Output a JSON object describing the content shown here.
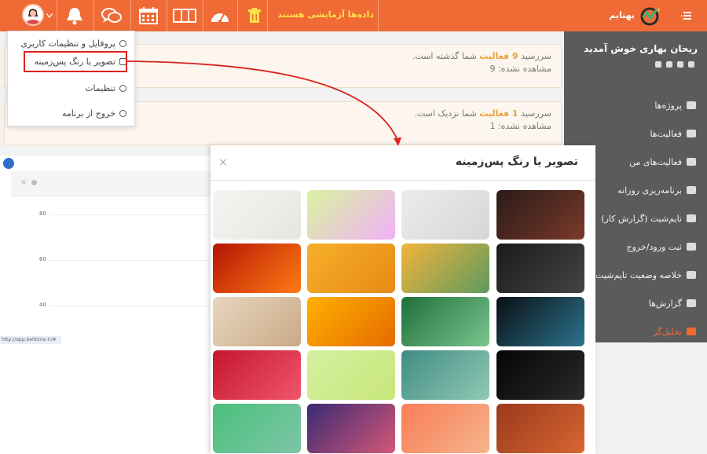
{
  "topbar": {
    "trial_label": "داده‌ها آزمایشی هستند",
    "brand": "بهتایم",
    "bg": "#f06a35"
  },
  "sidebar": {
    "welcome": "ریحان بهاری خوش آمدید",
    "items": [
      {
        "label": "پروژه‌ها",
        "icon": "projects-icon"
      },
      {
        "label": "فعالیت‌ها",
        "icon": "activities-icon"
      },
      {
        "label": "فعالیت‌های من",
        "icon": "my-activities-icon"
      },
      {
        "label": "برنامه‌ریزی روزانه",
        "icon": "calendar-grid-icon"
      },
      {
        "label": "تایم‌شیت (گزارش کار)",
        "icon": "timesheet-icon"
      },
      {
        "label": "ثبت ورود/خروج",
        "icon": "exchange-icon"
      },
      {
        "label": "خلاصه وضعیت تایم‌شیت‌ها",
        "icon": "summary-icon"
      },
      {
        "label": "گزارش‌ها",
        "icon": "report-icon"
      },
      {
        "label": "تحلیل‌گر",
        "icon": "analyzer-icon"
      }
    ],
    "active_color": "#f06a35"
  },
  "notices": [
    {
      "prefix": "سررسید",
      "count": "9 فعالیت",
      "suffix": "شما گذشته است.",
      "unseen": "مشاهده نشده: 9"
    },
    {
      "prefix": "سررسید",
      "count": "1 فعالیت",
      "suffix": "شما نزدیک است.",
      "unseen": "مشاهده نشده: 1"
    }
  ],
  "dropdown": {
    "items": [
      {
        "label": "پروفایل و تنظیمات کاربری",
        "icon": "user-icon"
      },
      {
        "label": "تصویر یا رنگ پس‌زمینه",
        "icon": "image-icon"
      },
      {
        "label": "تنظیمات",
        "icon": "gear-icon"
      },
      {
        "label": "خروج از برنامه",
        "icon": "power-icon"
      }
    ]
  },
  "chart": {
    "y_ticks": [
      "80",
      "60",
      "40"
    ],
    "status_url": "http://app.behtime.ir/#"
  },
  "modal": {
    "title": "تصویر یا رنگ پس‌زمینه",
    "close": "×",
    "thumbnails": [
      {
        "name": "desert-dunes",
        "colors": [
          "#2b1a18",
          "#7a3b2a"
        ]
      },
      {
        "name": "plant-pot",
        "colors": [
          "#ececec",
          "#d6d6d6"
        ]
      },
      {
        "name": "pastel-gradient",
        "colors": [
          "#d8f3a0",
          "#f1b0f6"
        ]
      },
      {
        "name": "palm-leaf",
        "colors": [
          "#f4f4f2",
          "#e6e6e0"
        ]
      },
      {
        "name": "water-drops",
        "colors": [
          "#1a1a1a",
          "#444444"
        ]
      },
      {
        "name": "eucalyptus",
        "colors": [
          "#f3b43c",
          "#5e9a5e"
        ]
      },
      {
        "name": "orange-waves",
        "colors": [
          "#f6b02a",
          "#e78a15"
        ]
      },
      {
        "name": "red-orange-smoke",
        "colors": [
          "#b41605",
          "#ff7a12"
        ]
      },
      {
        "name": "blue-smoke",
        "colors": [
          "#0a0f14",
          "#2d7490"
        ]
      },
      {
        "name": "green-leaf-stripes",
        "colors": [
          "#1f6f3a",
          "#7bc48e"
        ]
      },
      {
        "name": "yellow-flower-bee",
        "colors": [
          "#ffb000",
          "#e56b00"
        ]
      },
      {
        "name": "wood-leaves",
        "colors": [
          "#e8d6c0",
          "#c9a985"
        ]
      },
      {
        "name": "night-road",
        "colors": [
          "#050505",
          "#2a2a2a"
        ]
      },
      {
        "name": "teal-texture",
        "colors": [
          "#3f8c84",
          "#91c9b4"
        ]
      },
      {
        "name": "watermelon",
        "colors": [
          "#d4f0a0",
          "#c8e67a"
        ]
      },
      {
        "name": "red-abstract",
        "colors": [
          "#c4162e",
          "#f0566b"
        ]
      },
      {
        "name": "brown-gradient",
        "colors": [
          "#9a3a1e",
          "#d86630"
        ]
      },
      {
        "name": "peach-gradient",
        "colors": [
          "#f97d57",
          "#f5b48c"
        ]
      },
      {
        "name": "indigo-sunset",
        "colors": [
          "#3a2a73",
          "#d45778"
        ]
      },
      {
        "name": "green-gradient",
        "colors": [
          "#4bbf7b",
          "#7dc6a7"
        ]
      }
    ]
  }
}
